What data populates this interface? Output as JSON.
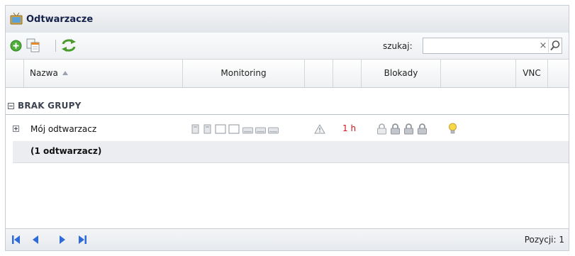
{
  "panel": {
    "title": "Odtwarzacze"
  },
  "toolbar": {
    "search_label": "szukaj:",
    "search_value": "",
    "clear_symbol": "×",
    "icons": [
      "add-icon",
      "copy-icon",
      "refresh-icon"
    ]
  },
  "columns": [
    "Nazwa",
    "Monitoring",
    "Blokady",
    "VNC"
  ],
  "sort": {
    "column": "Nazwa",
    "direction": "ascending"
  },
  "group": {
    "name": "BRAK GRUPY"
  },
  "rows": [
    {
      "name": "Mój odtwarzacz",
      "monitoring_icons": [
        "player-small-icon",
        "player-small-icon",
        "screen-off-icon",
        "screen-off-icon",
        "drive-icon",
        "drive-icon",
        "drive-icon",
        "warning-icon"
      ],
      "time": "1 h",
      "lock_icons": [
        "lock-open-icon",
        "lock-icon",
        "lock-icon",
        "lock-icon"
      ],
      "vnc_icon": "lightbulb-icon"
    }
  ],
  "summary": "(1 odtwarzacz)",
  "footer": {
    "position_label": "Pozycji: 1"
  },
  "colors": {
    "title": "#15224b",
    "time_alert": "#d2141c",
    "pager_blue": "#2f6bd8"
  }
}
